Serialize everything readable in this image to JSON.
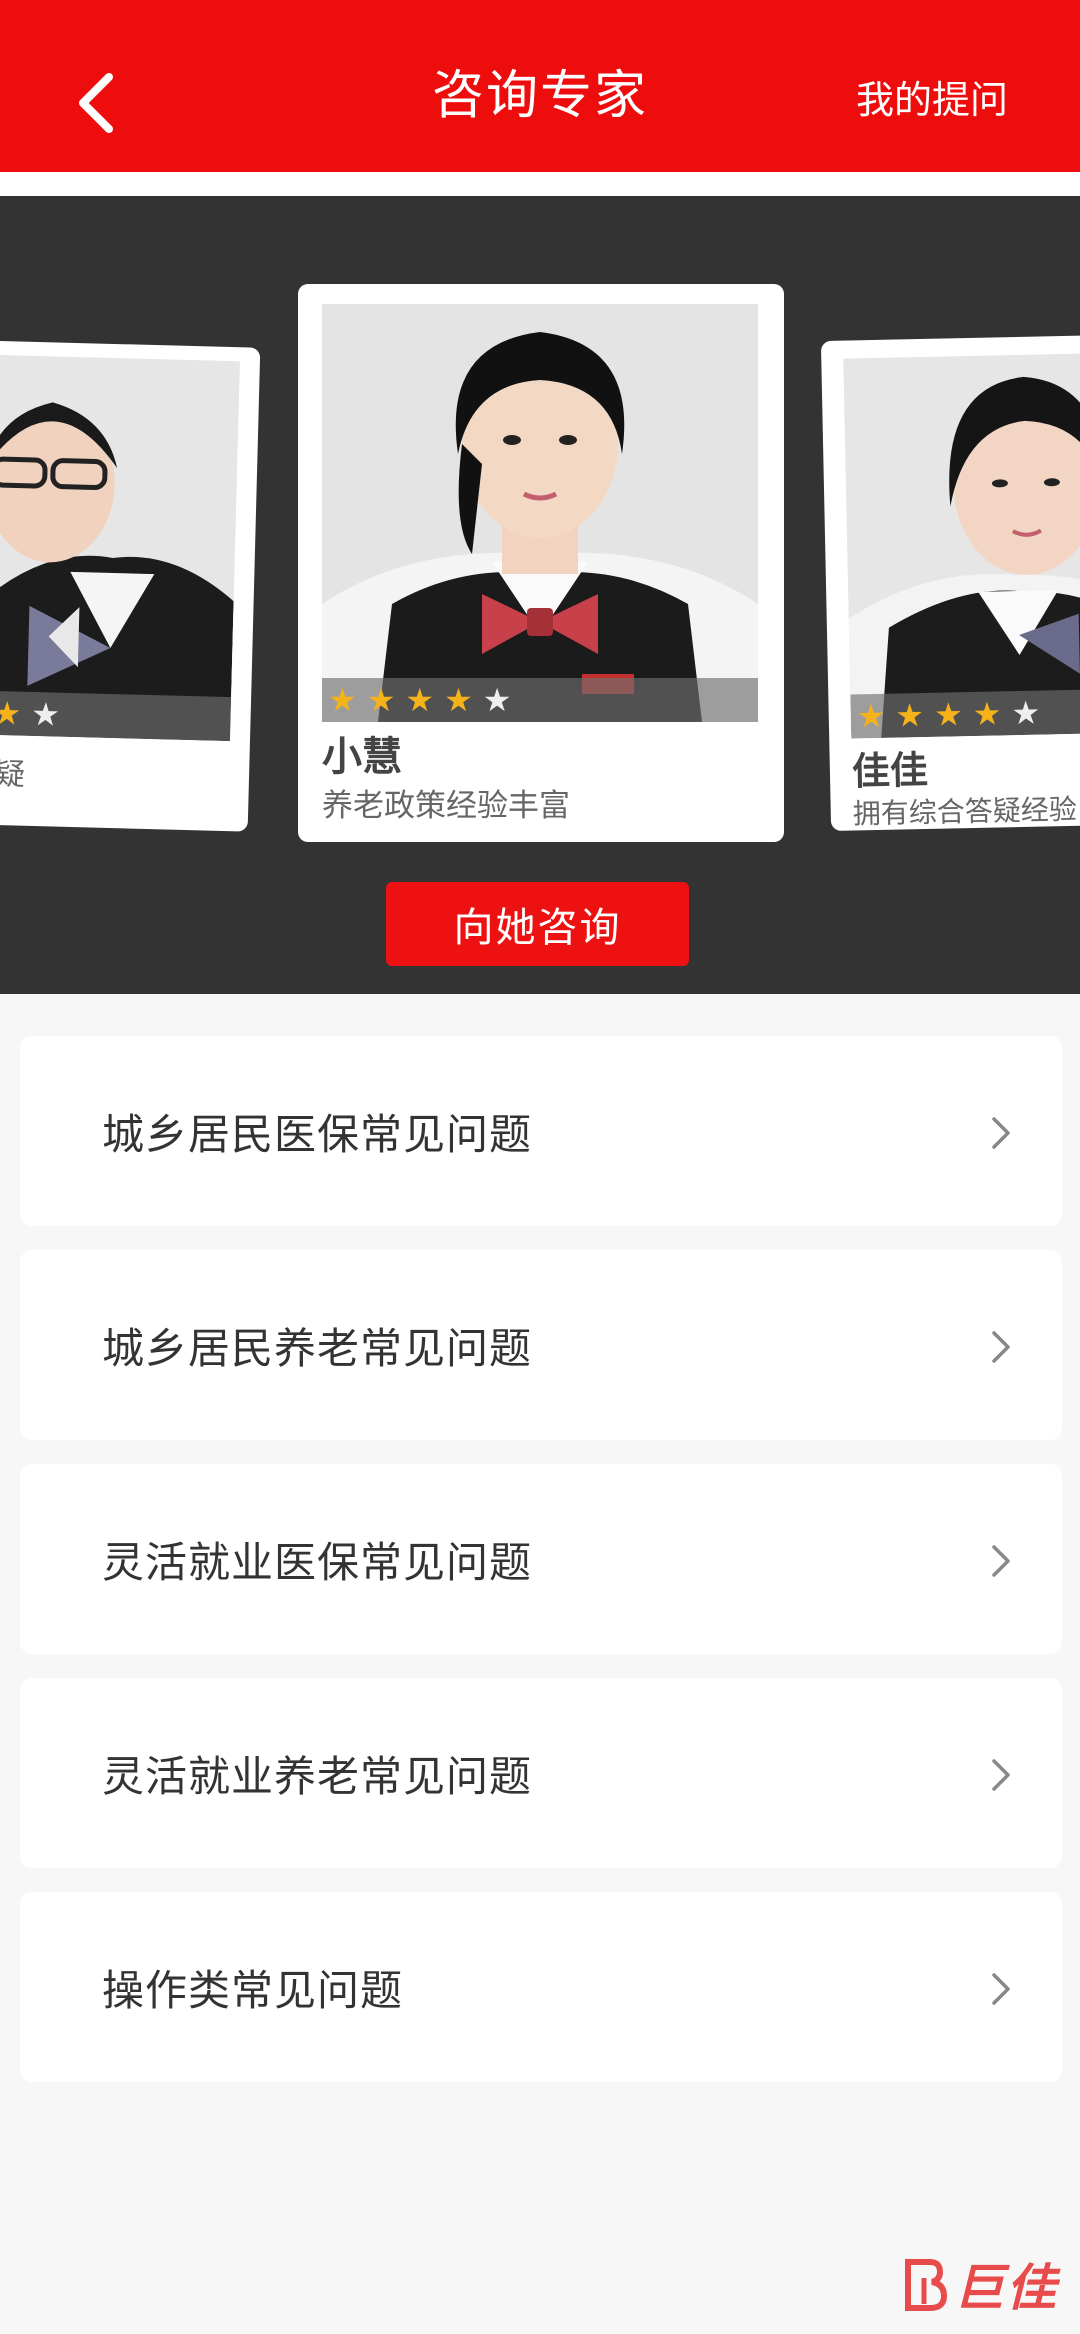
{
  "header": {
    "title": "咨询专家",
    "right_action": "我的提问"
  },
  "experts": {
    "left": {
      "name": "",
      "desc": "疑",
      "rating": 4
    },
    "center": {
      "name": "小慧",
      "desc": "养老政策经验丰富",
      "rating": 4
    },
    "right": {
      "name": "佳佳",
      "desc": "拥有综合答疑经验",
      "rating": 4
    }
  },
  "consult_button": "向她咨询",
  "faq": [
    {
      "label": "城乡居民医保常见问题"
    },
    {
      "label": "城乡居民养老常见问题"
    },
    {
      "label": "灵活就业医保常见问题"
    },
    {
      "label": "灵活就业养老常见问题"
    },
    {
      "label": "操作类常见问题"
    }
  ],
  "watermark": "巨佳",
  "colors": {
    "primary": "#ee0d0d",
    "carousel_bg": "#333333",
    "star_on": "#f6b21b",
    "star_off": "#eeeeee"
  }
}
